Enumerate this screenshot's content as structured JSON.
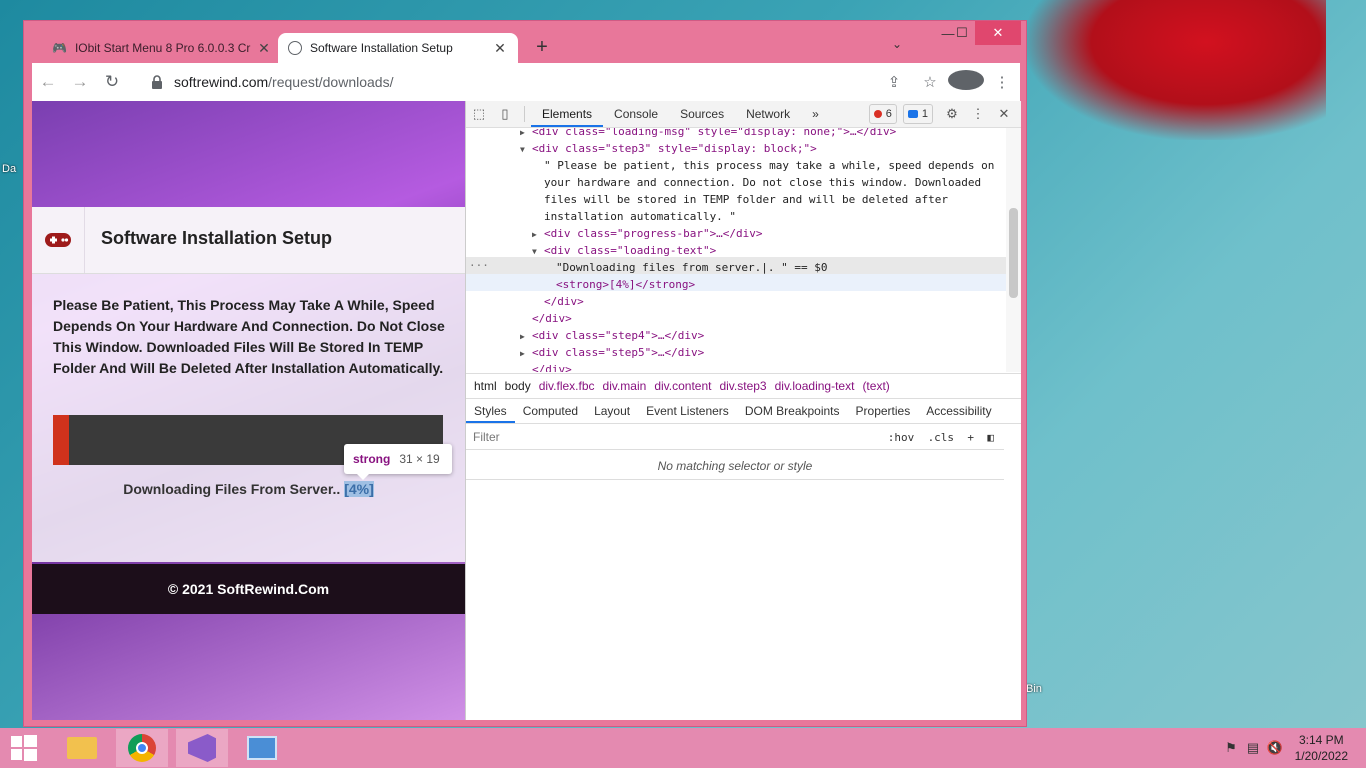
{
  "browser": {
    "tabs": [
      {
        "title": "IObit Start Menu 8 Pro 6.0.0.3 Cr",
        "active": false,
        "close": "✕"
      },
      {
        "title": "Software Installation Setup",
        "active": true,
        "close": "✕"
      }
    ],
    "new_tab": "+",
    "tab_menu": "⌄",
    "window_controls": {
      "minimize": "—",
      "maximize": "☐",
      "close": "✕"
    },
    "url": {
      "host": "softrewind.com",
      "path": "/request/downloads/"
    }
  },
  "page": {
    "header_title": "Software Installation Setup",
    "message": "Please Be Patient, This Process May Take A While, Speed Depends On Your Hardware And Connection. Do Not Close This Window. Downloaded Files Will Be Stored In TEMP Folder And Will Be Deleted After Installation Automatically.",
    "progress": 0.04,
    "download_text": "Downloading Files From Server..",
    "download_pct": "[4%]",
    "footer": "© 2021 SoftRewind.Com",
    "tooltip": {
      "tag": "strong",
      "dims": "31 × 19"
    }
  },
  "devtools": {
    "tabs": [
      "Elements",
      "Console",
      "Sources",
      "Network"
    ],
    "more": "»",
    "error_count": "6",
    "message_count": "1",
    "dom_lines": [
      {
        "indent": 0,
        "arrow": "▶",
        "html": "<div class=\"loading-msg\" style=\"display: none;\">…</div>"
      },
      {
        "indent": 0,
        "arrow": "▼",
        "html": "<div class=\"step3\" style=\"display: block;\">"
      },
      {
        "indent": 1,
        "arrow": "",
        "html": "\" Please be patient, this process may take a while, speed depends on"
      },
      {
        "indent": 1,
        "arrow": "",
        "html": "your hardware and connection. Do not close this window. Downloaded"
      },
      {
        "indent": 1,
        "arrow": "",
        "html": "files will be stored in TEMP folder and will be deleted after"
      },
      {
        "indent": 1,
        "arrow": "",
        "html": "installation automatically. \""
      },
      {
        "indent": 1,
        "arrow": "▶",
        "html": "<div class=\"progress-bar\">…</div>"
      },
      {
        "indent": 1,
        "arrow": "▼",
        "html": "<div class=\"loading-text\">"
      },
      {
        "indent": 2,
        "arrow": "",
        "html": "\"Downloading files from server.|. \" == $0"
      },
      {
        "indent": 2,
        "arrow": "",
        "html": "<strong>[4%]</strong>"
      },
      {
        "indent": 1,
        "arrow": "",
        "html": "</div>"
      },
      {
        "indent": 0,
        "arrow": "",
        "html": "</div>"
      },
      {
        "indent": 0,
        "arrow": "▶",
        "html": "<div class=\"step4\">…</div>"
      },
      {
        "indent": 0,
        "arrow": "▶",
        "html": "<div class=\"step5\">…</div>"
      },
      {
        "indent": 0,
        "arrow": "",
        "html": "</div>"
      }
    ],
    "breadcrumbs": [
      "html",
      "body",
      "div.flex.fbc",
      "div.main",
      "div.content",
      "div.step3",
      "div.loading-text",
      "(text)"
    ],
    "subtabs": [
      "Styles",
      "Computed",
      "Layout",
      "Event Listeners",
      "DOM Breakpoints",
      "Properties",
      "Accessibility"
    ],
    "filter_placeholder": "Filter",
    "hov": ":hov",
    "cls": ".cls",
    "plus": "+",
    "no_match": "No matching selector or style"
  },
  "desktop": {
    "label_left": "Da",
    "label_right": "Bin"
  },
  "taskbar": {
    "time": "3:14 PM",
    "date": "1/20/2022"
  }
}
